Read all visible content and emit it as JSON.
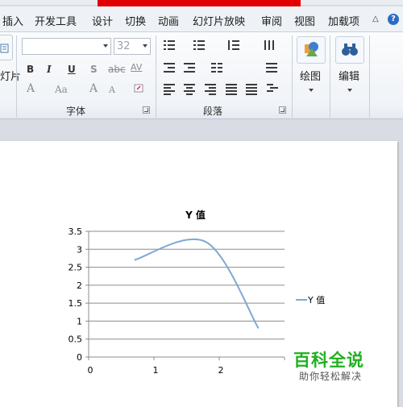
{
  "menu": {
    "tabs": [
      "插入",
      "开发工具",
      "设计",
      "切换",
      "动画",
      "幻灯片放映",
      "审阅",
      "视图",
      "加载项"
    ],
    "help_label": "?"
  },
  "ribbon": {
    "left_stub_label": "灯片",
    "font_group": {
      "label": "字体",
      "font_name": "",
      "font_size": "32",
      "tools": {
        "bold": "B",
        "italic": "I",
        "underline": "U",
        "shadow": "S",
        "strike": "abc",
        "spacing": "AV",
        "text_color": "A",
        "case": "Aa",
        "grow": "A",
        "shrink": "A"
      }
    },
    "paragraph_group": {
      "label": "段落"
    },
    "drawing": {
      "label": "绘图"
    },
    "editing": {
      "label": "编辑"
    }
  },
  "colors": {
    "accent_red": "#e00000",
    "series_line": "#7fa8d4",
    "watermark_green": "#20b020"
  },
  "chart_data": {
    "type": "line",
    "title": "Y 值",
    "xlabel": "",
    "ylabel": "",
    "xlim": [
      0,
      3
    ],
    "ylim": [
      0,
      3.5
    ],
    "x_ticks": [
      "0",
      "1",
      "2"
    ],
    "y_ticks": [
      "0",
      "0.5",
      "1",
      "1.5",
      "2",
      "2.5",
      "3",
      "3.5"
    ],
    "grid": true,
    "legend_position": "right",
    "smooth": true,
    "series": [
      {
        "name": "Y 值",
        "x": [
          0.7,
          1.8,
          2.6
        ],
        "y": [
          2.7,
          3.2,
          0.8
        ]
      }
    ]
  },
  "watermark": {
    "title": "百科全说",
    "subtitle": "助你轻松解决"
  }
}
